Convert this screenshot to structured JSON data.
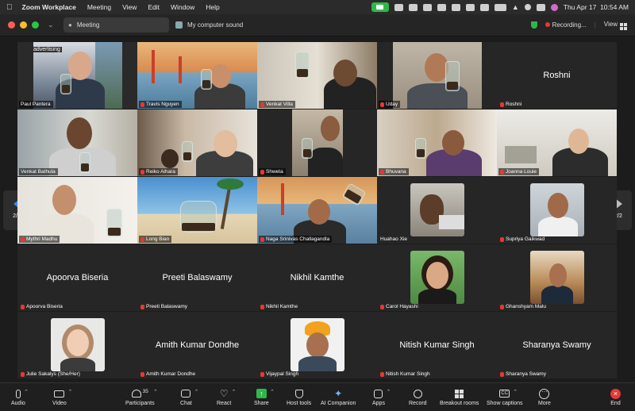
{
  "menubar": {
    "app": "Zoom Workplace",
    "items": [
      "Meeting",
      "View",
      "Edit",
      "Window",
      "Help"
    ],
    "clock": "Thu Apr 17  10:54 AM"
  },
  "titlebar": {
    "meeting_tab": "Meeting",
    "sound_tab": "My computer sound",
    "recording": "Recording...",
    "view": "View"
  },
  "pager": {
    "left": "2/2",
    "right": "2/2"
  },
  "participants": [
    {
      "name": "Paul Pantera",
      "muted": false,
      "kind": "video"
    },
    {
      "name": "Travis Nguyen",
      "muted": true,
      "kind": "video"
    },
    {
      "name": "Venkat Villa",
      "muted": true,
      "kind": "video"
    },
    {
      "name": "Uday",
      "muted": true,
      "kind": "video"
    },
    {
      "name": "Roshni",
      "muted": true,
      "kind": "name",
      "display": "Roshni"
    },
    {
      "name": "Venkat Bathula",
      "muted": false,
      "kind": "video"
    },
    {
      "name": "Reiko Aihara",
      "muted": true,
      "kind": "video"
    },
    {
      "name": "Shweta",
      "muted": true,
      "kind": "video"
    },
    {
      "name": "Bhuvana",
      "muted": true,
      "kind": "video"
    },
    {
      "name": "Joanna Louie",
      "muted": true,
      "kind": "video"
    },
    {
      "name": "Mythri Madhu",
      "muted": true,
      "kind": "video"
    },
    {
      "name": "Long Bian",
      "muted": true,
      "kind": "video"
    },
    {
      "name": "Naga Srinivas Challagandla",
      "muted": true,
      "kind": "video"
    },
    {
      "name": "Huahao Xie",
      "muted": false,
      "kind": "avatar"
    },
    {
      "name": "Supriya Gaikwad",
      "muted": true,
      "kind": "avatar"
    },
    {
      "name": "Apoorva Biseria",
      "muted": true,
      "kind": "name",
      "display": "Apoorva Biseria"
    },
    {
      "name": "Preeti Balaswamy",
      "muted": true,
      "kind": "name",
      "display": "Preeti Balaswamy"
    },
    {
      "name": "Nikhil Kamthe",
      "muted": true,
      "kind": "name",
      "display": "Nikhil Kamthe"
    },
    {
      "name": "Carol Hayashi",
      "muted": true,
      "kind": "avatar"
    },
    {
      "name": "Ghanshyam Malu",
      "muted": true,
      "kind": "avatar"
    },
    {
      "name": "Julie Sakalys (She/Her)",
      "muted": true,
      "kind": "avatar"
    },
    {
      "name": "Amith Kumar Dondhe",
      "muted": true,
      "kind": "name",
      "display": "Amith Kumar Dondhe"
    },
    {
      "name": "Vijaypal Singh",
      "muted": true,
      "kind": "avatar"
    },
    {
      "name": "Nitish Kumar Singh",
      "muted": true,
      "kind": "name",
      "display": "Nitish Kumar Singh"
    },
    {
      "name": "Sharanya Swamy",
      "muted": true,
      "kind": "name",
      "display": "Sharanya Swamy"
    }
  ],
  "video_text": {
    "paul_banner": "advertising"
  },
  "toolbar": {
    "audio": "Audio",
    "video": "Video",
    "participants": "Participants",
    "participants_count": "35",
    "chat": "Chat",
    "react": "React",
    "share": "Share",
    "host_tools": "Host tools",
    "ai_companion": "AI Companion",
    "apps": "Apps",
    "record": "Record",
    "breakout": "Breakout rooms",
    "captions": "Show captions",
    "more": "More",
    "end": "End"
  },
  "colors": {
    "share_green": "#2fb84a",
    "end_red": "#e53935",
    "accent_blue": "#2f8cff"
  }
}
